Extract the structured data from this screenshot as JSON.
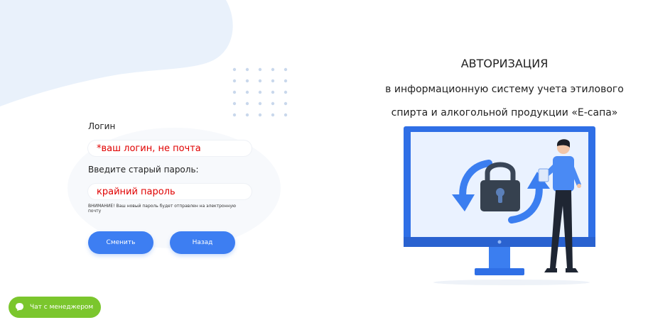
{
  "form": {
    "login_label": "Логин",
    "login_value": "*ваш логин, не почта",
    "password_label": "Введите старый пароль:",
    "password_value": "крайний пароль",
    "warning": "ВНИМАНИЕ! Ваш новый пароль будет отправлен на электронную почту",
    "change_button": "Сменить",
    "back_button": "Назад"
  },
  "header": {
    "title": "АВТОРИЗАЦИЯ",
    "subtitle_line1": "в информационную систему учета этилового",
    "subtitle_line2": "спирта и алкогольной продукции «Е-сапа»"
  },
  "chat": {
    "label": "Чат с менеджером"
  },
  "colors": {
    "accent": "#3d7ef2",
    "chat": "#7bc62d",
    "blob": "#e9f1fb",
    "hint_text": "#e00000"
  },
  "icons": {
    "chat": "chat-bubble-icon",
    "illustration": "lock-sync-monitor-illustration"
  }
}
